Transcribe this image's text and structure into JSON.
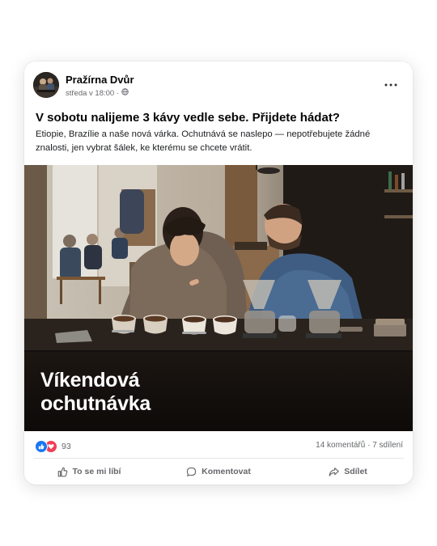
{
  "post": {
    "page_name": "Pražírna Dvůr",
    "timestamp": "středa v 18:00 ·",
    "audience_icon": "globe-icon",
    "more_icon": "more-options-icon",
    "title": "V sobotu nalijeme 3 kávy vedle sebe. Přijdete hádat?",
    "body": "Etiopie, Brazílie a naše nová várka. Ochutnává se naslepo — nepotřebujete žádné znalosti, jen vybrat šálek, ke kterému se chcete vrátit.",
    "image_overlay": [
      "Víkendová",
      "ochutnávka"
    ]
  },
  "stats": {
    "reaction_icons": [
      "like-icon",
      "love-icon"
    ],
    "reaction_count": "93",
    "comments_shares": "14 komentářů · 7 sdílení"
  },
  "actions": {
    "like": "To se mi líbí",
    "comment": "Komentovat",
    "share": "Sdílet"
  },
  "colors": {
    "like_blue": "#1877f2",
    "love_red": "#f33e58",
    "secondary_text": "#65676b"
  }
}
